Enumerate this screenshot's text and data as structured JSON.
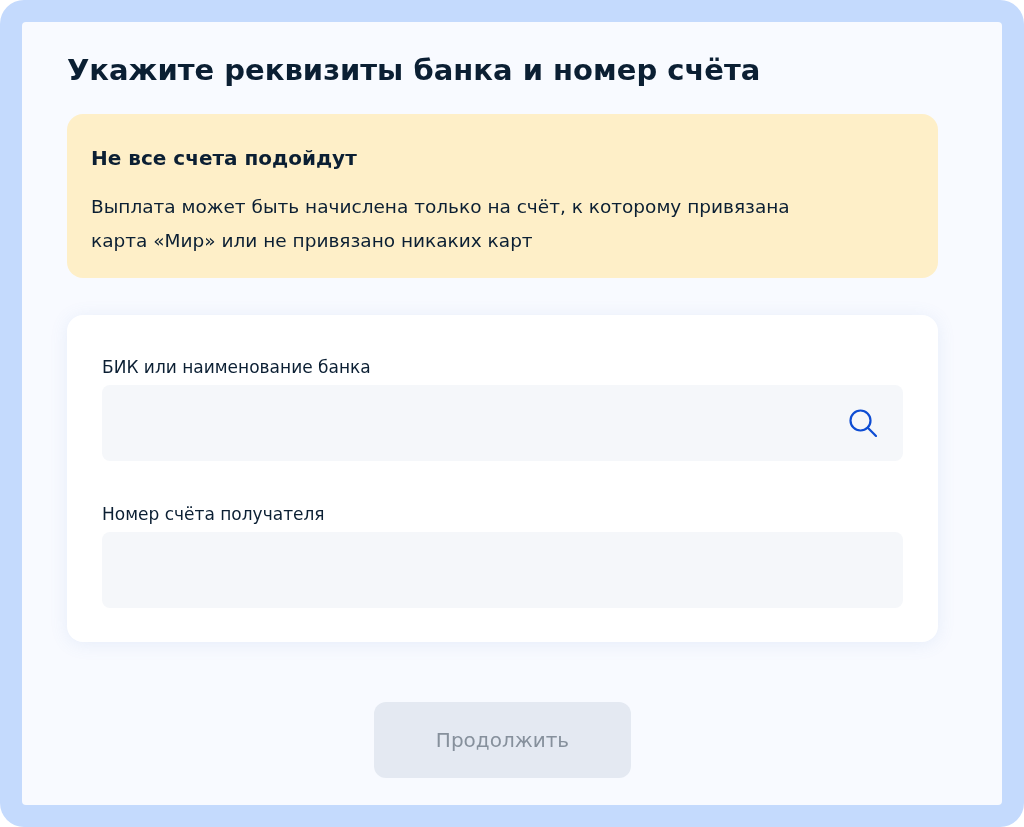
{
  "title": "Укажите реквизиты банка и номер счёта",
  "notice": {
    "title": "Не все счета подойдут",
    "text": "Выплата может быть начислена только на счёт, к которому привязана карта «Мир» или не привязано никаких карт"
  },
  "fields": [
    {
      "kind": "search",
      "label": "БИК или наименование банка"
    },
    {
      "kind": "text",
      "label": "Номер счёта получателя"
    }
  ],
  "continue_button": {
    "label": "Продолжить",
    "disabled": true
  }
}
